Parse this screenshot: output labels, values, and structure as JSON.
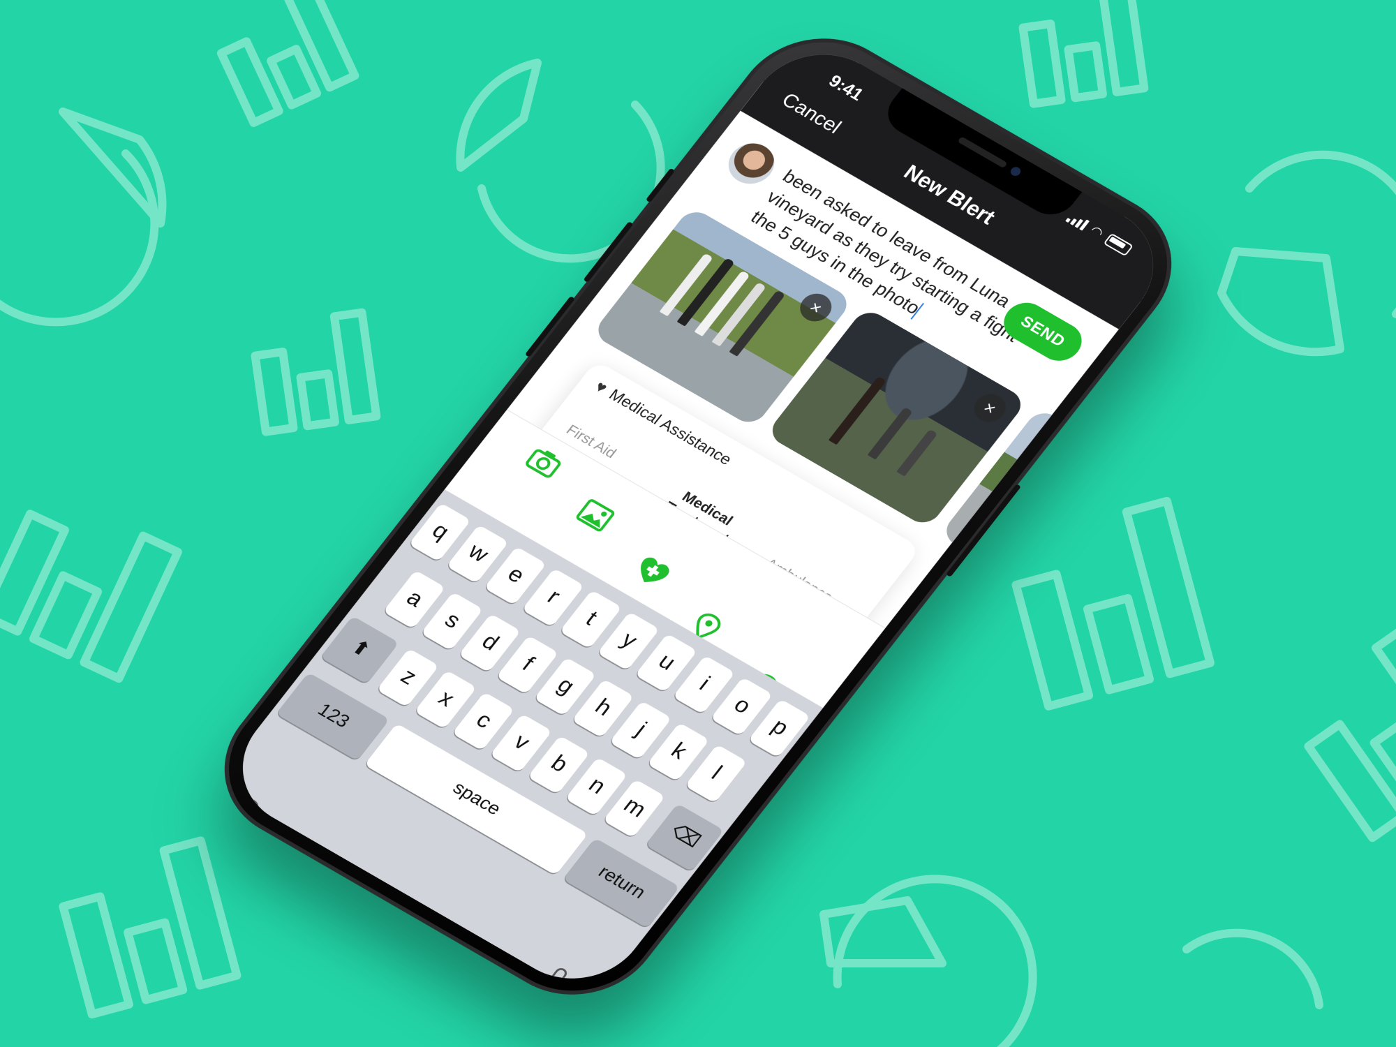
{
  "status_bar": {
    "time": "9:41"
  },
  "nav": {
    "cancel": "Cancel",
    "title": "New Blert"
  },
  "compose": {
    "message": "been asked to leave from Luna vineyard as they try starting a fight the 5 guys in the photo",
    "send": "SEND"
  },
  "photos": [
    {
      "close": "×"
    },
    {
      "close": "×"
    }
  ],
  "medical": {
    "heading": "Medical Assistance",
    "levels": [
      "First Aid",
      "Medical Treatment",
      "Ambulance Called"
    ],
    "selected_level": "Medical Treatment",
    "slider_fraction": 0.5,
    "close": "×"
  },
  "toolbar": {
    "icons": [
      "camera-icon",
      "image-icon",
      "medical-heart-icon",
      "location-pin-icon",
      "at-icon"
    ],
    "at": "@"
  },
  "keyboard": {
    "row1": [
      "q",
      "w",
      "e",
      "r",
      "t",
      "y",
      "u",
      "i",
      "o",
      "p"
    ],
    "row2": [
      "a",
      "s",
      "d",
      "f",
      "g",
      "h",
      "j",
      "k",
      "l"
    ],
    "row3": [
      "z",
      "x",
      "c",
      "v",
      "b",
      "n",
      "m"
    ],
    "numbers": "123",
    "space": "space",
    "return": "return"
  },
  "colors": {
    "background": "#22d4a6",
    "accent": "#1fbf2e",
    "slider": "#f5a623"
  }
}
